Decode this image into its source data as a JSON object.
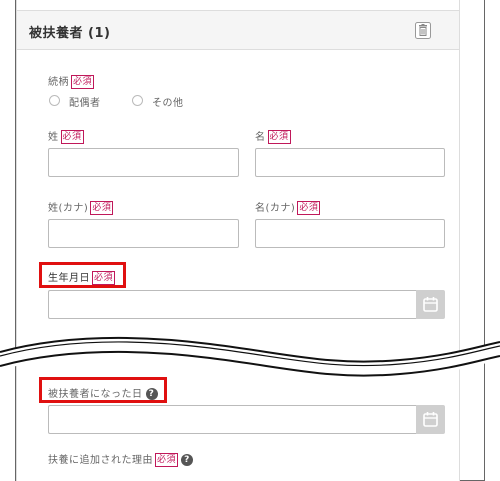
{
  "section": {
    "title": "被扶養者 (1)",
    "delete_icon": "trash-icon"
  },
  "relationship": {
    "label": "続柄",
    "required": "必須",
    "options": [
      "配偶者",
      "その他"
    ]
  },
  "last_name": {
    "label": "姓",
    "required": "必須",
    "value": ""
  },
  "first_name": {
    "label": "名",
    "required": "必須",
    "value": ""
  },
  "last_name_kana": {
    "label": "姓(カナ)",
    "required": "必須",
    "value": ""
  },
  "first_name_kana": {
    "label": "名(カナ)",
    "required": "必須",
    "value": ""
  },
  "birthdate": {
    "label": "生年月日",
    "required": "必須",
    "value": "",
    "icon": "calendar-icon"
  },
  "dependent_date": {
    "label": "被扶養者になった日",
    "help_icon": "question-circle-icon",
    "value": "",
    "icon": "calendar-icon"
  },
  "reason": {
    "label": "扶養に追加された理由",
    "required": "必須"
  },
  "colors": {
    "required": "#c0185a",
    "highlight": "#e01010",
    "header_bg": "#f5f5f5"
  }
}
